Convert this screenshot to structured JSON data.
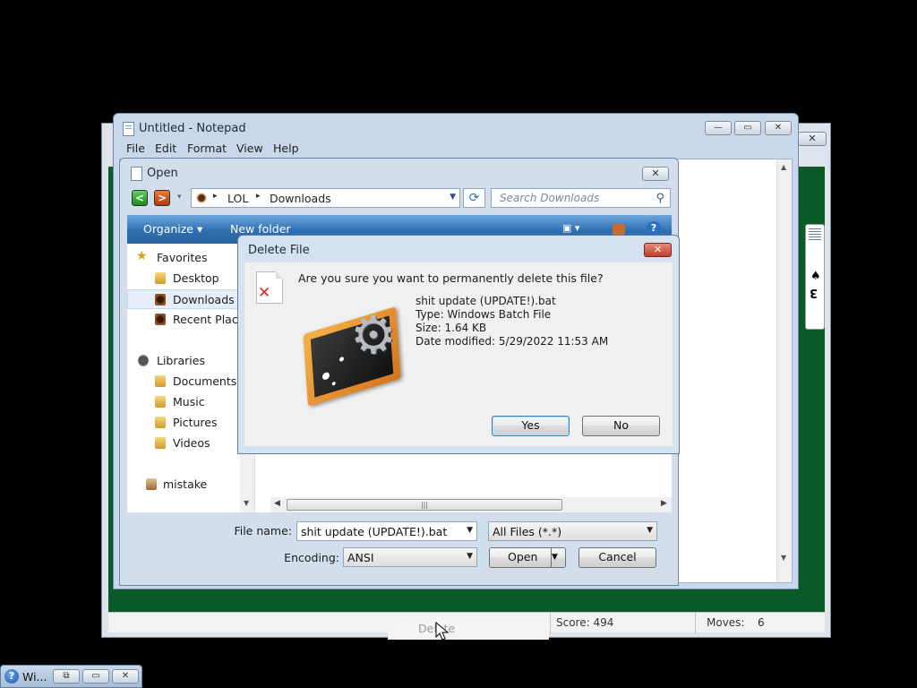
{
  "solitaire": {
    "close_label": "✕",
    "card_suit": "♠",
    "card_rank": "3",
    "score": "Score: 494",
    "moves_label": "Moves:",
    "moves_value": "6"
  },
  "notepad": {
    "title": "Untitled - Notepad",
    "min_label": "—",
    "max_label": "▭",
    "close_label": "✕",
    "menu": [
      "File",
      "Edit",
      "Format",
      "View",
      "Help"
    ]
  },
  "open_dialog": {
    "title": "Open",
    "close_label": "✕",
    "back_label": "<",
    "forward_label": ">",
    "history_label": "▾",
    "breadcrumb": [
      "LOL",
      "Downloads"
    ],
    "breadcrumb_sep": "▸",
    "address_dropdown": "▼",
    "refresh_label": "⟳",
    "search_placeholder": "Search Downloads",
    "search_glyph": "⚲",
    "organize_label": "Organize ▾",
    "new_folder_label": "New folder",
    "view_glyph": "▣ ▾",
    "help_glyph": "?",
    "nav": {
      "favorites": "Favorites",
      "desktop": "Desktop",
      "downloads": "Downloads",
      "recent": "Recent Places",
      "libraries": "Libraries",
      "documents": "Documents",
      "music": "Music",
      "pictures": "Pictures",
      "videos": "Videos",
      "user": "mistake"
    },
    "filename_label": "File name:",
    "filename_value": "shit update (UPDATE!).bat",
    "filetype_value": "All Files  (*.*)",
    "encoding_label": "Encoding:",
    "encoding_value": "ANSI",
    "open_label": "Open",
    "cancel_label": "Cancel",
    "dropdown_arrow": "▼",
    "scroll_left": "◀",
    "scroll_right": "▶",
    "scroll_down": "▼",
    "scroll_up": "▲",
    "thumb_grip": "|||"
  },
  "delete_dialog": {
    "title": "Delete File",
    "close_label": "✕",
    "question": "Are you sure you want to permanently delete this file?",
    "file_name": "shit update (UPDATE!).bat",
    "file_type": "Type: Windows Batch File",
    "file_size": "Size: 1.64 KB",
    "file_modified": "Date modified: 5/29/2022 11:53 AM",
    "yes_label": "Yes",
    "no_label": "No",
    "file_x": "✕",
    "gear_glyph": "⚙"
  },
  "background": {
    "ghost_button_label": "Delete"
  },
  "taskbar_window": {
    "icon_glyph": "?",
    "title": "Wi...",
    "restore_label": "⧉",
    "max_label": "▭",
    "close_label": "✕"
  }
}
